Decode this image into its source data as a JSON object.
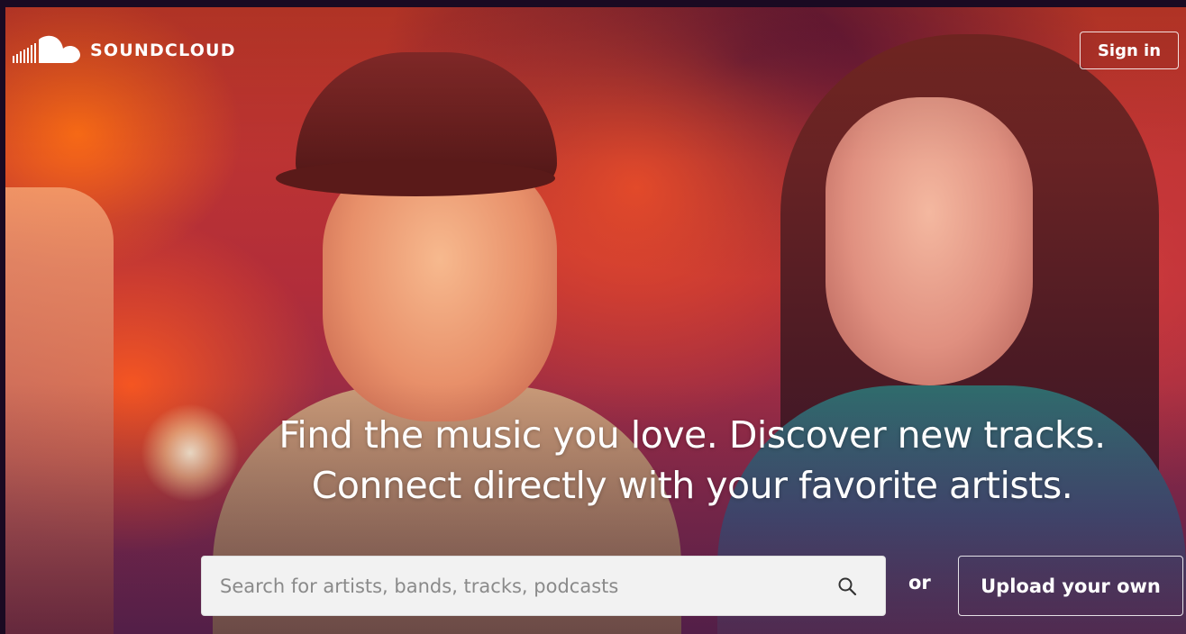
{
  "header": {
    "brand": "SOUNDCLOUD",
    "sign_in_label": "Sign in"
  },
  "hero": {
    "tagline_line1": "Find the music you love. Discover new tracks.",
    "tagline_line2": "Connect directly with your favorite artists."
  },
  "search": {
    "placeholder": "Search for artists, bands, tracks, podcasts",
    "value": "",
    "icon": "search-icon"
  },
  "actions": {
    "or_label": "or",
    "upload_label": "Upload your own"
  },
  "colors": {
    "search_bg": "#f2f2f2",
    "text_white": "#ffffff"
  }
}
